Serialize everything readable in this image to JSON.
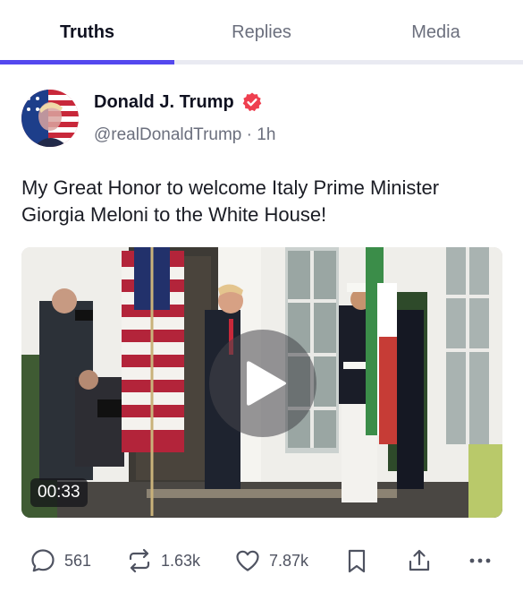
{
  "tabs": [
    {
      "label": "Truths",
      "active": true
    },
    {
      "label": "Replies",
      "active": false
    },
    {
      "label": "Media",
      "active": false
    }
  ],
  "accent_color": "#5448ee",
  "post": {
    "author": {
      "name": "Donald J. Trump",
      "handle": "@realDonaldTrump",
      "time": "1h",
      "verified": true,
      "verified_color": "#ef3f4f"
    },
    "text": "My Great Honor to welcome Italy Prime Minister Giorgia Meloni to the White House!",
    "video": {
      "duration": "00:33"
    },
    "actions": {
      "replies": "561",
      "retruths": "1.63k",
      "likes": "7.87k"
    }
  }
}
